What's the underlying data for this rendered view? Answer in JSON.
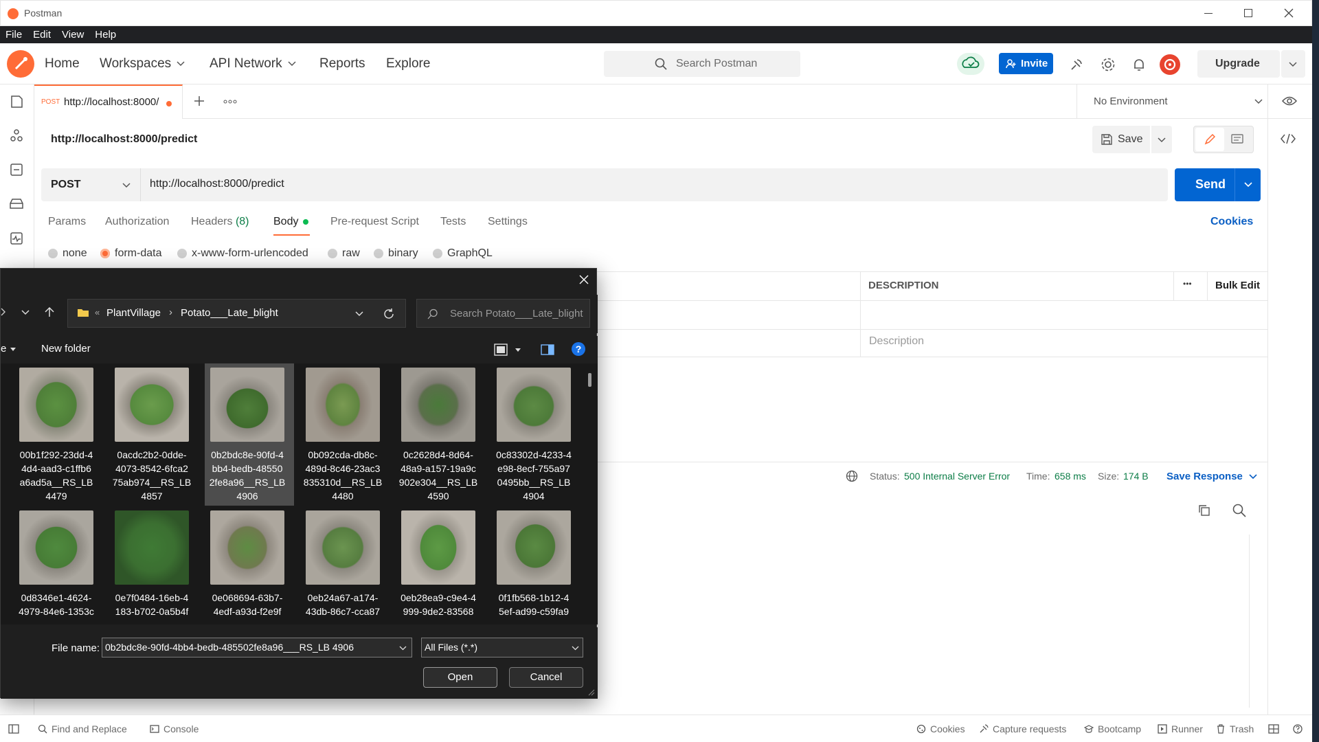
{
  "window": {
    "title": "Postman"
  },
  "menu": [
    "File",
    "Edit",
    "View",
    "Help"
  ],
  "nav": {
    "home": "Home",
    "workspaces": "Workspaces",
    "api_network": "API Network",
    "reports": "Reports",
    "explore": "Explore",
    "search_placeholder": "Search Postman",
    "invite": "Invite",
    "upgrade": "Upgrade"
  },
  "tab": {
    "method": "POST",
    "url": "http://localhost:8000/",
    "unsaved": true
  },
  "environment": "No Environment",
  "request": {
    "title": "http://localhost:8000/predict",
    "save_label": "Save",
    "method": "POST",
    "url": "http://localhost:8000/predict",
    "send_label": "Send"
  },
  "request_tabs": [
    {
      "label": "Params"
    },
    {
      "label": "Authorization"
    },
    {
      "label": "Headers",
      "count": "(8)"
    },
    {
      "label": "Body",
      "active": true
    },
    {
      "label": "Pre-request Script"
    },
    {
      "label": "Tests"
    },
    {
      "label": "Settings"
    }
  ],
  "cookies_link": "Cookies",
  "body_types": [
    "none",
    "form-data",
    "x-www-form-urlencoded",
    "raw",
    "binary",
    "GraphQL"
  ],
  "body_selected": "form-data",
  "params_table": {
    "description_header": "DESCRIPTION",
    "more": "•••",
    "bulk_edit": "Bulk Edit",
    "description_placeholder": "Description"
  },
  "response": {
    "status_label": "Status:",
    "status_value": "500 Internal Server Error",
    "time_label": "Time:",
    "time_value": "658 ms",
    "size_label": "Size:",
    "size_value": "174 B",
    "save_response": "Save Response"
  },
  "file_dialog": {
    "path": [
      "PlantVillage",
      "Potato___Late_blight"
    ],
    "path_prefix": "«",
    "search_placeholder": "Search Potato___Late_blight",
    "new_folder": "New folder",
    "organize_fragment": "e",
    "files": [
      {
        "name": [
          "00b1f292-23dd-4",
          "4d4-aad3-c1ffb6",
          "a6ad5a__RS_LB",
          "4479"
        ]
      },
      {
        "name": [
          "0acdc2b2-0dde-",
          "4073-8542-6fca2",
          "75ab974__RS_LB",
          "4857"
        ]
      },
      {
        "name": [
          "0b2bdc8e-90fd-4",
          "bb4-bedb-48550",
          "2fe8a96__RS_LB",
          "4906"
        ],
        "selected": true
      },
      {
        "name": [
          "0b092cda-db8c-",
          "489d-8c46-23ac3",
          "835310d__RS_LB",
          "4480"
        ]
      },
      {
        "name": [
          "0c2628d4-8d64-",
          "48a9-a157-19a9c",
          "902e304__RS_LB",
          "4590"
        ]
      },
      {
        "name": [
          "0c83302d-4233-4",
          "e98-8ecf-755a97",
          "0495bb__RS_LB",
          "4904"
        ]
      },
      {
        "name": [
          "0d8346e1-4624-",
          "4979-84e6-1353c"
        ]
      },
      {
        "name": [
          "0e7f0484-16eb-4",
          "183-b702-0a5b4f"
        ]
      },
      {
        "name": [
          "0e068694-63b7-",
          "4edf-a93d-f2e9f"
        ]
      },
      {
        "name": [
          "0eb24a67-a174-",
          "43db-86c7-cca87"
        ]
      },
      {
        "name": [
          "0eb28ea9-c9e4-4",
          "999-9de2-83568"
        ]
      },
      {
        "name": [
          "0f1fb568-1b12-4",
          "5ef-ad99-c59fa9"
        ]
      }
    ],
    "file_name_label": "File name:",
    "file_name_value": "0b2bdc8e-90fd-4bb4-bedb-485502fe8a96___RS_LB 4906",
    "file_type": "All Files (*.*)",
    "open": "Open",
    "cancel": "Cancel"
  },
  "status_bar": {
    "find_replace": "Find and Replace",
    "console": "Console",
    "cookies": "Cookies",
    "capture": "Capture requests",
    "bootcamp": "Bootcamp",
    "runner": "Runner",
    "trash": "Trash"
  },
  "colors": {
    "brand_orange": "#ff6c37",
    "send_blue": "#0265d2",
    "status_green": "#0c7d47",
    "link_blue": "#0b5fc4",
    "dialog_bg": "#1f1f1f"
  }
}
